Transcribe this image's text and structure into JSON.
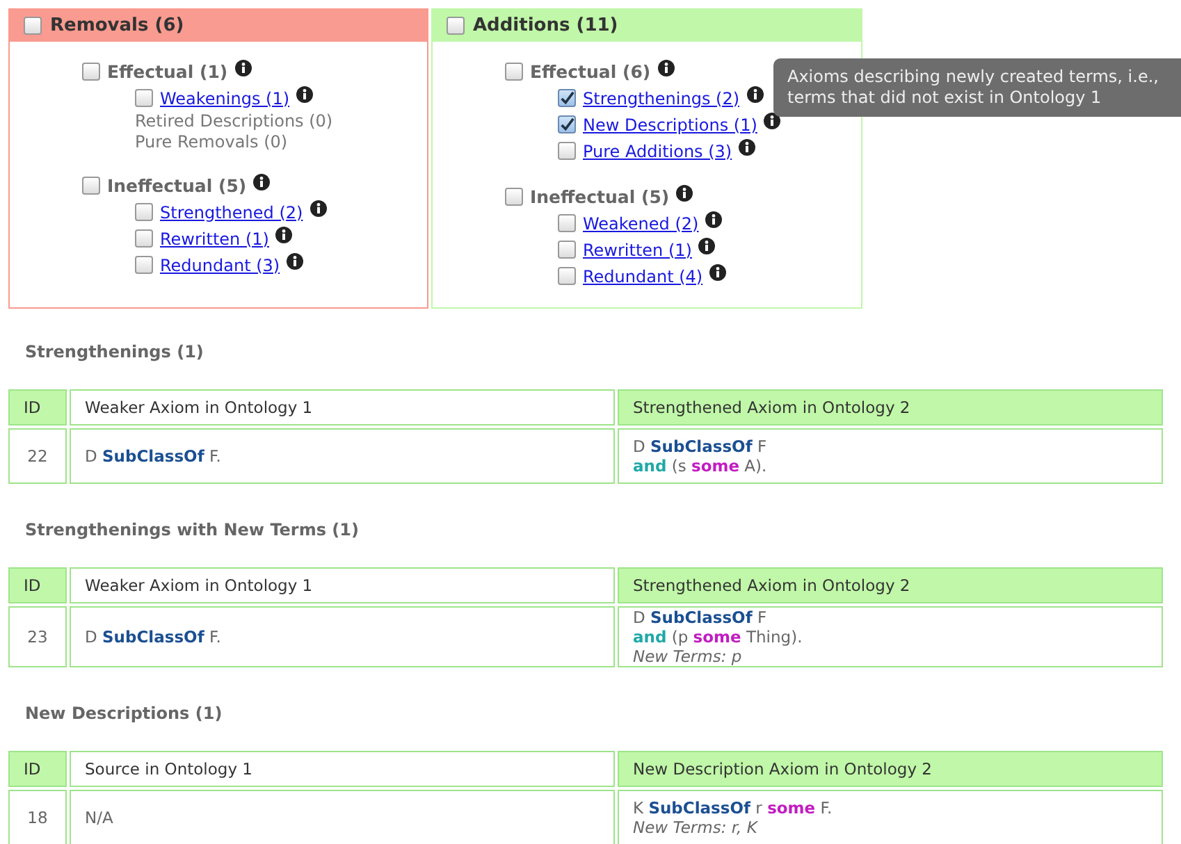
{
  "panels": [
    {
      "title": "Removals (6)",
      "color": "#f99b90",
      "checked": false,
      "groups": [
        {
          "label": "Effectual (1)",
          "checked": false,
          "items": [
            {
              "kind": "link",
              "label": "Weakenings (1)",
              "checked": false
            },
            {
              "kind": "plain",
              "label": "Retired Descriptions (0)"
            },
            {
              "kind": "plain",
              "label": "Pure Removals (0)"
            }
          ]
        },
        {
          "label": "Ineffectual (5)",
          "checked": false,
          "items": [
            {
              "kind": "link",
              "label": "Strengthened (2)",
              "checked": false
            },
            {
              "kind": "link",
              "label": "Rewritten (1)",
              "checked": false
            },
            {
              "kind": "link",
              "label": "Redundant (3)",
              "checked": false
            }
          ]
        }
      ]
    },
    {
      "title": "Additions (11)",
      "color": "#c0f7a8",
      "checked": false,
      "groups": [
        {
          "label": "Effectual (6)",
          "checked": false,
          "items": [
            {
              "kind": "link",
              "label": "Strengthenings (2)",
              "checked": true
            },
            {
              "kind": "link",
              "label": "New Descriptions (1)",
              "checked": true
            },
            {
              "kind": "link",
              "label": "Pure Additions (3)",
              "checked": false
            }
          ]
        },
        {
          "label": "Ineffectual (5)",
          "checked": false,
          "items": [
            {
              "kind": "link",
              "label": "Weakened (2)",
              "checked": false
            },
            {
              "kind": "link",
              "label": "Rewritten (1)",
              "checked": false
            },
            {
              "kind": "link",
              "label": "Redundant (4)",
              "checked": false
            }
          ]
        }
      ]
    }
  ],
  "tooltip": "Axioms describing newly created terms, i.e., terms that did not exist in Ontology 1",
  "sections": [
    {
      "title": "Strengthenings (1)",
      "columns": [
        "ID",
        "Weaker Axiom in Ontology 1",
        "Strengthened Axiom in Ontology 2"
      ],
      "rows": [
        {
          "id": "22",
          "source": {
            "lines": [
              [
                {
                  "kind": "plain",
                  "text": "D "
                },
                {
                  "kind": "keyword",
                  "text": "SubClassOf"
                },
                {
                  "kind": "plain",
                  "text": " F."
                }
              ]
            ]
          },
          "target": {
            "lines": [
              [
                {
                  "kind": "plain",
                  "text": "D "
                },
                {
                  "kind": "keyword",
                  "text": "SubClassOf"
                },
                {
                  "kind": "plain",
                  "text": " F"
                }
              ],
              [
                {
                  "kind": "connective",
                  "text": "and"
                },
                {
                  "kind": "plain",
                  "text": " (s "
                },
                {
                  "kind": "restriction",
                  "text": "some"
                },
                {
                  "kind": "plain",
                  "text": " A)."
                }
              ]
            ]
          }
        }
      ]
    },
    {
      "title": "Strengthenings with New Terms (1)",
      "columns": [
        "ID",
        "Weaker Axiom in Ontology 1",
        "Strengthened Axiom in Ontology 2"
      ],
      "rows": [
        {
          "id": "23",
          "source": {
            "lines": [
              [
                {
                  "kind": "plain",
                  "text": "D "
                },
                {
                  "kind": "keyword",
                  "text": "SubClassOf"
                },
                {
                  "kind": "plain",
                  "text": " F."
                }
              ]
            ]
          },
          "target": {
            "lines": [
              [
                {
                  "kind": "plain",
                  "text": "D "
                },
                {
                  "kind": "keyword",
                  "text": "SubClassOf"
                },
                {
                  "kind": "plain",
                  "text": " F"
                }
              ],
              [
                {
                  "kind": "connective",
                  "text": "and"
                },
                {
                  "kind": "plain",
                  "text": " (p "
                },
                {
                  "kind": "restriction",
                  "text": "some"
                },
                {
                  "kind": "plain",
                  "text": " Thing)."
                }
              ]
            ],
            "new_terms": "New Terms: p"
          }
        }
      ]
    },
    {
      "title": "New Descriptions (1)",
      "columns": [
        "ID",
        "Source in Ontology 1",
        "New Description Axiom in Ontology 2"
      ],
      "rows": [
        {
          "id": "18",
          "source": {
            "text": "N/A"
          },
          "target": {
            "lines": [
              [
                {
                  "kind": "plain",
                  "text": "K "
                },
                {
                  "kind": "keyword",
                  "text": "SubClassOf"
                },
                {
                  "kind": "plain",
                  "text": " r "
                },
                {
                  "kind": "restriction",
                  "text": "some"
                },
                {
                  "kind": "plain",
                  "text": " F."
                }
              ]
            ],
            "new_terms": "New Terms: r, K"
          }
        }
      ]
    }
  ]
}
